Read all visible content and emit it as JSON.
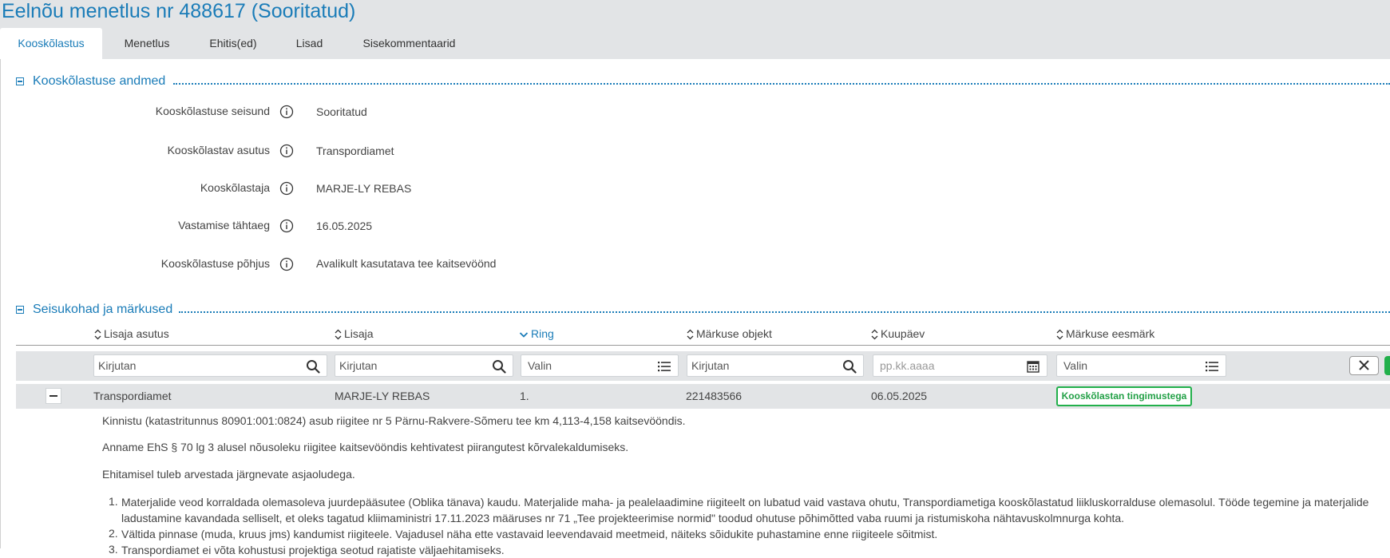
{
  "page": {
    "title": "Eelnõu menetlus nr 488617 (Sooritatud)"
  },
  "tabs": [
    {
      "label": "Kooskõlastus",
      "active": true
    },
    {
      "label": "Menetlus"
    },
    {
      "label": "Ehitis(ed)"
    },
    {
      "label": "Lisad"
    },
    {
      "label": "Sisekommentaarid"
    }
  ],
  "section1": {
    "title": "Kooskõlastuse andmed",
    "fields": [
      {
        "label": "Kooskõlastuse seisund",
        "value": "Sooritatud"
      },
      {
        "label": "Kooskõlastav asutus",
        "value": "Transpordiamet"
      },
      {
        "label": "Kooskõlastaja",
        "value": "MARJE-LY REBAS"
      },
      {
        "label": "Vastamise tähtaeg",
        "value": "16.05.2025"
      },
      {
        "label": "Kooskõlastuse põhjus",
        "value": "Avalikult kasutatava tee kaitsevöönd"
      }
    ]
  },
  "section2": {
    "title": "Seisukohad ja märkused",
    "columns": [
      "Lisaja asutus",
      "Lisaja",
      "Ring",
      "Märkuse objekt",
      "Kuupäev",
      "Märkuse eesmärk"
    ],
    "filters": [
      "Kirjutan",
      "Kirjutan",
      "Valin",
      "Kirjutan",
      "pp.kk.aaaa",
      "Valin"
    ],
    "row": {
      "asutus": "Transpordiamet",
      "lisaja": "MARJE-LY REBAS",
      "ring": "1.",
      "objekt": "221483566",
      "kuupaev": "06.05.2025",
      "eesmark": "Kooskõlastan tingimustega"
    },
    "comment": {
      "p1": "Kinnistu (katastritunnus 80901:001:0824) asub riigitee nr 5 Pärnu-Rakvere-Sõmeru tee km 4,113-4,158 kaitsevööndis.",
      "p2": "Anname EhS § 70 lg 3 alusel nõusoleku riigitee kaitsevööndis kehtivatest piirangutest kõrvalekaldumiseks.",
      "p3": "Ehitamisel tuleb arvestada järgnevate asjaoludega.",
      "items": [
        {
          "num": "1.",
          "line1": "Materjalide veod korraldada olemasoleva juurdepääsutee (Oblika tänava) kaudu. Materjalide maha- ja pealelaadimine riigiteelt on lubatud vaid vastava ohutu, Transpordiametiga kooskõlastatud liikluskorralduse olemasolul. Tööde tegemine ja materjalide",
          "line2": "ladustamine kavandada selliselt, et oleks tagatud kliimaministri 17.11.2023 määruses nr 71 „Tee projekteerimise normid\" toodud ohutuse põhimõtted vaba ruumi ja ristumiskoha nähtavuskolmnurga kohta."
        },
        {
          "num": "2.",
          "line1": "Vältida pinnase (muda, kruus jms) kandumist riigiteele. Vajadusel näha ette vastavaid leevendavaid meetmeid, näiteks sõidukite puhastamine enne riigiteele sõitmist."
        },
        {
          "num": "3.",
          "line1": "Transpordiamet ei võta kohustusi projektiga seotud rajatiste väljaehitamiseks."
        }
      ]
    }
  },
  "colors": {
    "accent": "#1a7cb8",
    "badge": "#22b04b",
    "bar": "#e2e4e6"
  }
}
